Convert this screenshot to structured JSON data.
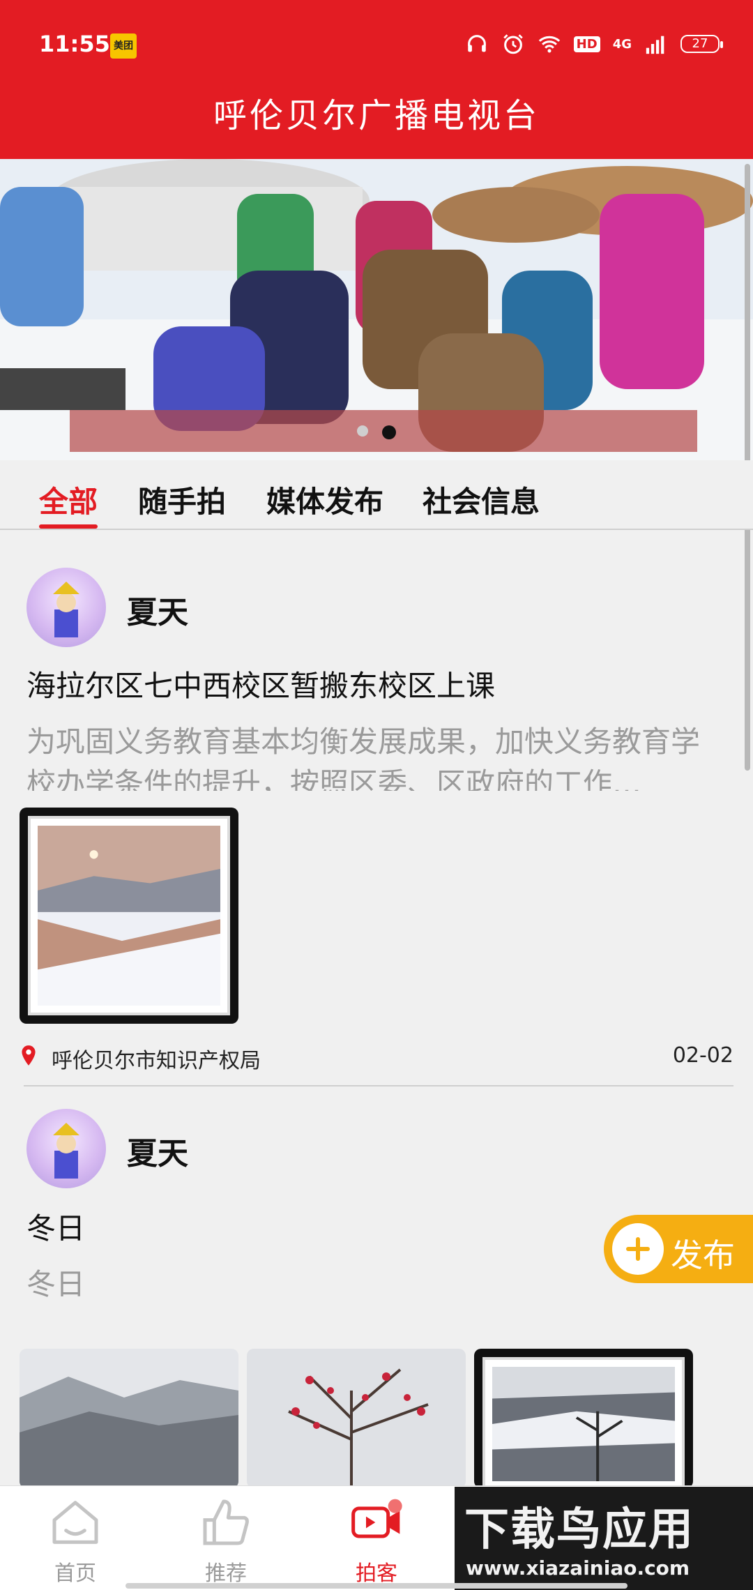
{
  "status_bar": {
    "time": "11:55",
    "app_badge": "美团",
    "network": "4G",
    "hd": "HD",
    "battery": "27"
  },
  "header": {
    "title": "呼伦贝尔广播电视台"
  },
  "banner": {
    "slides": 2,
    "active_slide": 2
  },
  "tabs": [
    {
      "label": "全部",
      "active": true
    },
    {
      "label": "随手拍",
      "active": false
    },
    {
      "label": "媒体发布",
      "active": false
    },
    {
      "label": "社会信息",
      "active": false
    }
  ],
  "posts": [
    {
      "username": "夏天",
      "title": "海拉尔区七中西校区暂搬东校区上课",
      "excerpt": "为巩固义务教育基本均衡发展成果，加快义务教育学校办学条件的提升，按照区委、区政府的工作…",
      "location": "呼伦贝尔市知识产权局",
      "date": "02-02"
    },
    {
      "username": "夏天",
      "title": "冬日",
      "excerpt": "冬日"
    }
  ],
  "publish_button": {
    "label": "发布"
  },
  "bottom_nav": [
    {
      "label": "首页",
      "icon": "home-icon",
      "active": false
    },
    {
      "label": "推荐",
      "icon": "thumbs-up-icon",
      "active": false
    },
    {
      "label": "拍客",
      "icon": "video-camera-icon",
      "active": true
    }
  ],
  "watermark": {
    "big": "下载鸟应用",
    "small": "www.xiazainiao.com"
  },
  "colors": {
    "brand_red": "#e31c23",
    "publish_orange": "#f5ae12"
  }
}
